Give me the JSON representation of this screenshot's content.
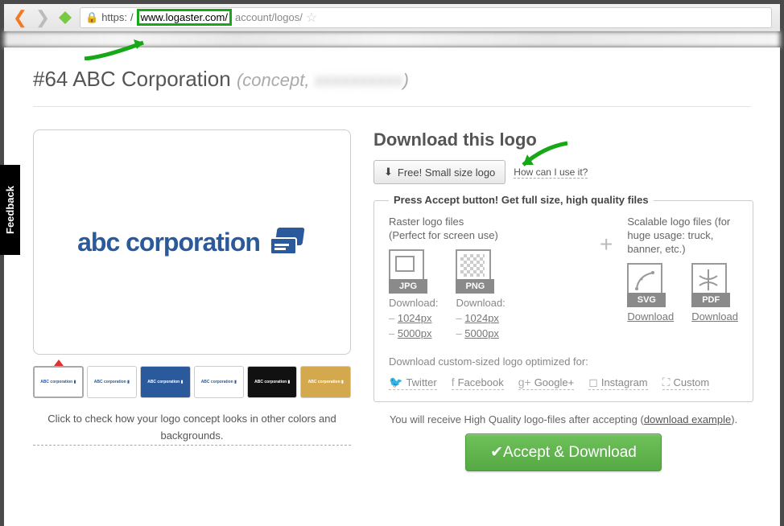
{
  "url": {
    "proto": "https:",
    "pre": "/",
    "host": "www.logaster.com/",
    "path": "account/logos/"
  },
  "feedback": "Feedback",
  "title": {
    "id": "#64",
    "name": "ABC Corporation",
    "sub_open": "(concept,",
    "sub_hidden": "xxxxxxxxxx",
    "sub_close": ")"
  },
  "logo_text": "abc corporation",
  "color_link": "Click to check how your logo concept looks in other colors and backgrounds.",
  "download": {
    "heading": "Download this logo",
    "free_btn": "Free! Small size logo",
    "how": "How can I use it?",
    "box_title": "Press Accept button! Get full size, high quality files",
    "raster": {
      "head": "Raster logo files",
      "sub": "(Perfect for screen use)",
      "dl": "Download:",
      "sizes": [
        "1024px",
        "5000px"
      ]
    },
    "scalable": {
      "head": "Scalable logo files (for huge usage: truck, banner, etc.)",
      "dl": "Download"
    },
    "formats": {
      "jpg": "JPG",
      "png": "PNG",
      "svg": "SVG",
      "pdf": "PDF"
    },
    "custom_head": "Download custom-sized logo optimized for:",
    "socials": [
      "Twitter",
      "Facebook",
      "Google+",
      "Instagram",
      "Custom"
    ],
    "receive": "You will receive High Quality logo-files after accepting (",
    "example": "download example",
    "receive_end": ").",
    "accept": "Accept & Download"
  }
}
